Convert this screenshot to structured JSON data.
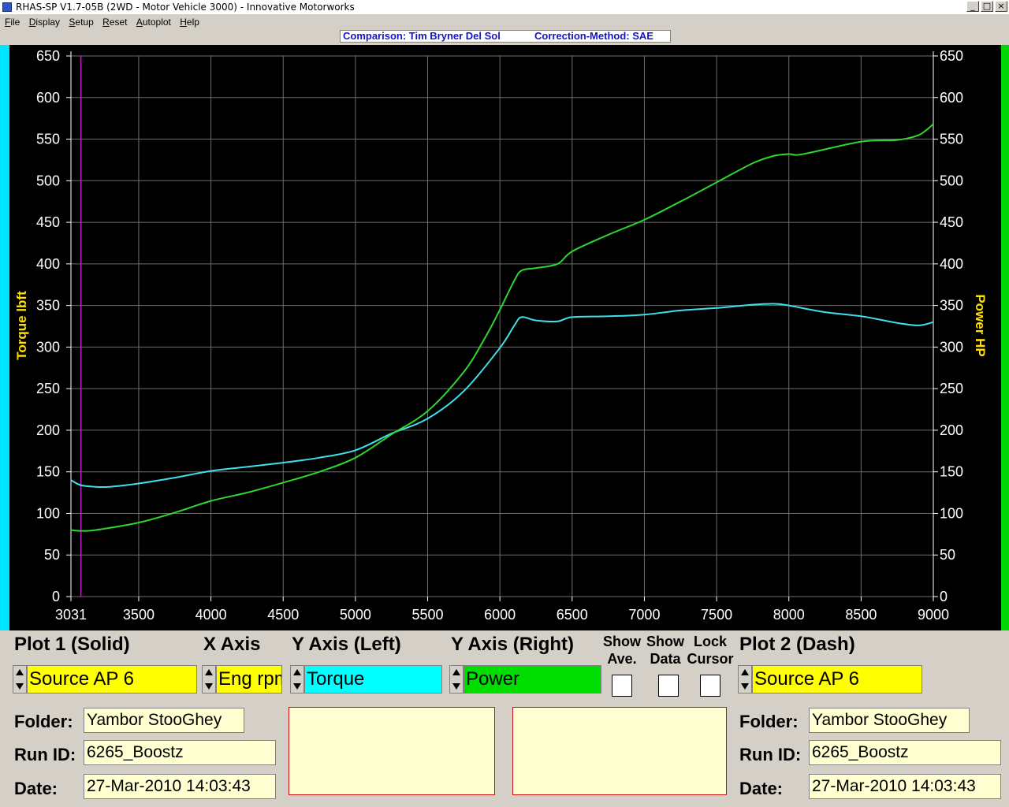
{
  "window": {
    "title": "RHAS-SP V1.7-05B  (2WD - Motor Vehicle 3000) - Innovative Motorworks",
    "min_glyph": "_",
    "restore_glyph": "□",
    "close_glyph": "×"
  },
  "menu": {
    "items": [
      {
        "hotkey": "F",
        "rest": "ile"
      },
      {
        "hotkey": "D",
        "rest": "isplay"
      },
      {
        "hotkey": "S",
        "rest": "etup"
      },
      {
        "hotkey": "R",
        "rest": "eset"
      },
      {
        "hotkey": "A",
        "rest": "utoplot"
      },
      {
        "hotkey": "H",
        "rest": "elp"
      }
    ]
  },
  "caption": {
    "comparison": "Comparison: Tim Bryner Del Sol",
    "correction": "Correction-Method: SAE"
  },
  "chart_data": {
    "type": "line",
    "xlabel": "",
    "ylabel_left": "Torque lbft",
    "ylabel_right": "Power HP",
    "xlim": [
      3031,
      9000
    ],
    "ylim": [
      0,
      650
    ],
    "x_ticks": [
      3031,
      3500,
      4000,
      4500,
      5000,
      5500,
      6000,
      6500,
      7000,
      7500,
      8000,
      8500,
      9000
    ],
    "y_ticks": [
      0,
      50,
      100,
      150,
      200,
      250,
      300,
      350,
      400,
      450,
      500,
      550,
      600,
      650
    ],
    "grid": true,
    "cursor_x": 3100,
    "colors": {
      "torque": "#3fe0ec",
      "power": "#2fd62f",
      "cursor": "#c020c0",
      "axis_text": "#ffffff",
      "axis_label": "#ffe000"
    },
    "series": [
      {
        "name": "Torque",
        "axis": "left",
        "x": [
          3031,
          3100,
          3200,
          3300,
          3500,
          3750,
          4000,
          4250,
          4500,
          4750,
          5000,
          5250,
          5500,
          5750,
          6000,
          6100,
          6150,
          6250,
          6400,
          6500,
          6750,
          7000,
          7250,
          7500,
          7750,
          7900,
          8000,
          8250,
          8500,
          8750,
          8900,
          9000
        ],
        "values": [
          140,
          134,
          132,
          132,
          136,
          143,
          151,
          156,
          161,
          167,
          176,
          196,
          214,
          247,
          299,
          326,
          336,
          332,
          331,
          336,
          337,
          339,
          344,
          347,
          351,
          352,
          350,
          342,
          337,
          329,
          326,
          330
        ]
      },
      {
        "name": "Power",
        "axis": "right",
        "x": [
          3031,
          3100,
          3200,
          3500,
          3750,
          4000,
          4250,
          4500,
          4750,
          5000,
          5250,
          5500,
          5750,
          5900,
          6000,
          6100,
          6150,
          6250,
          6400,
          6500,
          6750,
          7000,
          7250,
          7500,
          7750,
          7900,
          8000,
          8100,
          8500,
          8750,
          8900,
          9000
        ],
        "values": [
          80,
          79,
          80,
          89,
          101,
          115,
          125,
          137,
          150,
          167,
          195,
          223,
          270,
          312,
          345,
          380,
          392,
          395,
          400,
          415,
          435,
          453,
          475,
          498,
          521,
          530,
          532,
          532,
          547,
          549,
          555,
          568
        ]
      }
    ]
  },
  "panel": {
    "plot1_title": "Plot 1 (Solid)",
    "xaxis_title": "X Axis",
    "yleft_title": "Y Axis (Left)",
    "yright_title": "Y Axis (Right)",
    "show_ave_1": "Show",
    "show_ave_2": "Ave.",
    "show_data_1": "Show",
    "show_data_2": "Data",
    "lock_cursor_1": "Lock",
    "lock_cursor_2": "Cursor",
    "plot2_title": "Plot 2 (Dash)",
    "plot1_source": "Source AP 6",
    "xaxis_value": "Eng rpm",
    "yleft_value": "Torque",
    "yright_value": "Power",
    "plot2_source": "Source AP 6",
    "colors": {
      "source": "#ffff00",
      "torque": "#00ffff",
      "power": "#00dd00"
    },
    "left": {
      "folder_label": "Folder:",
      "folder": "Yambor StooGhey",
      "runid_label": "Run ID:",
      "runid": "6265_Boostz",
      "date_label": "Date:",
      "date": "27-Mar-2010  14:03:43"
    },
    "right": {
      "folder_label": "Folder:",
      "folder": "Yambor StooGhey",
      "runid_label": "Run ID:",
      "runid": "6265_Boostz",
      "date_label": "Date:",
      "date": "27-Mar-2010  14:03:43"
    }
  }
}
